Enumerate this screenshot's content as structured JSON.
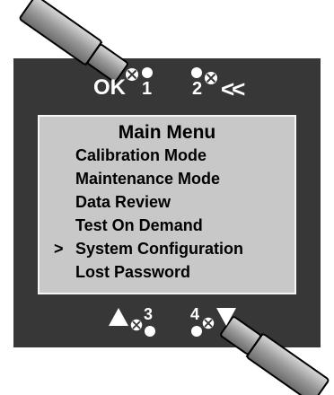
{
  "buttons": {
    "ok": {
      "label": "OK",
      "number": "1"
    },
    "back": {
      "label": "<<",
      "number": "2"
    },
    "up": {
      "number": "3"
    },
    "down": {
      "number": "4"
    }
  },
  "screen": {
    "title": "Main Menu",
    "cursor": ">",
    "items": [
      "Calibration Mode",
      "Maintenance Mode",
      "Data Review",
      "Test On Demand",
      "System Configuration",
      "Lost Password"
    ],
    "selected_index": 4
  },
  "colors": {
    "panel": "#373737",
    "lcd": "#c8c8c8",
    "label": "#ffffff"
  }
}
